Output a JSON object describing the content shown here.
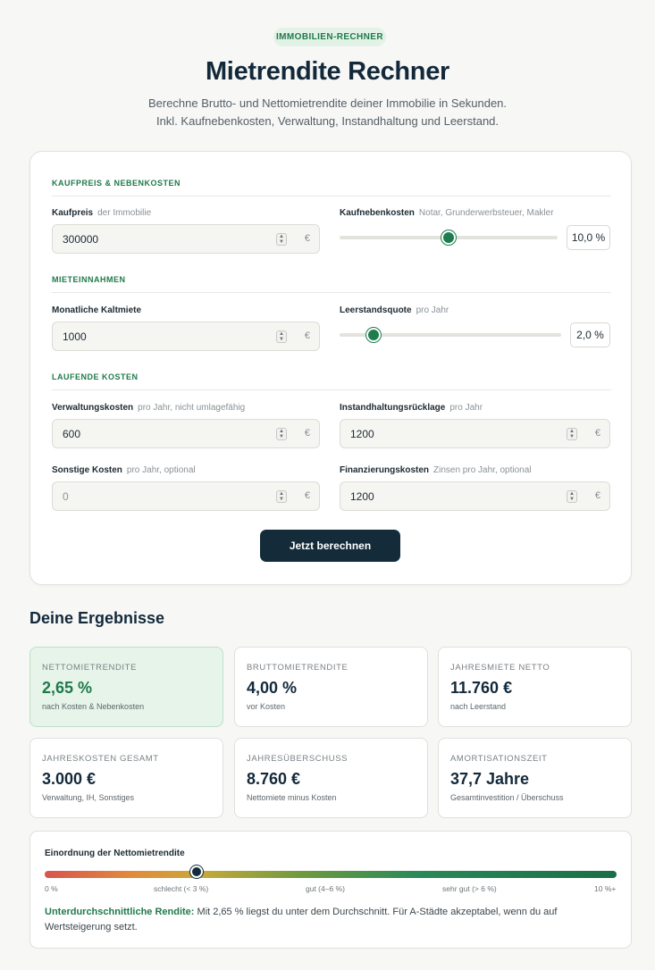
{
  "header": {
    "badge": "IMMOBILIEN-RECHNER",
    "title": "Mietrendite Rechner",
    "subtitle_line1": "Berechne Brutto- und Nettomietrendite deiner Immobilie in Sekunden.",
    "subtitle_line2": "Inkl. Kaufnebenkosten, Verwaltung, Instandhaltung und Leerstand."
  },
  "form": {
    "section_purchase": "KAUFPREIS & NEBENKOSTEN",
    "section_income": "MIETEINNAHMEN",
    "section_costs": "LAUFENDE KOSTEN",
    "kaufpreis": {
      "label": "Kaufpreis",
      "hint": "der Immobilie",
      "value": "300000",
      "unit": "€"
    },
    "kaufnebenkosten": {
      "label": "Kaufnebenkosten",
      "hint": "Notar, Grunderwerbsteuer, Makler",
      "display": "10,0 %",
      "fraction": 0.5
    },
    "kaltmiete": {
      "label": "Monatliche Kaltmiete",
      "hint": "",
      "value": "1000",
      "unit": "€"
    },
    "leerstandsquote": {
      "label": "Leerstandsquote",
      "hint": "pro Jahr",
      "display": "2,0 %",
      "fraction": 0.13
    },
    "verwaltung": {
      "label": "Verwaltungskosten",
      "hint": "pro Jahr, nicht umlagefähig",
      "value": "600",
      "unit": "€"
    },
    "instandhaltung": {
      "label": "Instandhaltungsrücklage",
      "hint": "pro Jahr",
      "value": "1200",
      "unit": "€"
    },
    "sonstige": {
      "label": "Sonstige Kosten",
      "hint": "pro Jahr, optional",
      "placeholder": "0",
      "unit": "€"
    },
    "finanzierung": {
      "label": "Finanzierungskosten",
      "hint": "Zinsen pro Jahr, optional",
      "value": "1200",
      "unit": "€"
    },
    "submit_label": "Jetzt berechnen"
  },
  "results": {
    "heading": "Deine Ergebnisse",
    "cards": [
      {
        "label": "NETTOMIETRENDITE",
        "value": "2,65 %",
        "note": "nach Kosten & Nebenkosten"
      },
      {
        "label": "BRUTTOMIETRENDITE",
        "value": "4,00 %",
        "note": "vor Kosten"
      },
      {
        "label": "JAHRESMIETE NETTO",
        "value": "11.760 €",
        "note": "nach Leerstand"
      },
      {
        "label": "JAHRESKOSTEN GESAMT",
        "value": "3.000 €",
        "note": "Verwaltung, IH, Sonstiges"
      },
      {
        "label": "JAHRESÜBERSCHUSS",
        "value": "8.760 €",
        "note": "Nettomiete minus Kosten"
      },
      {
        "label": "AMORTISATIONSZEIT",
        "value": "37,7 Jahre",
        "note": "Gesamtinvestition / Überschuss"
      }
    ]
  },
  "scale": {
    "title": "Einordnung der Nettomietrendite",
    "marker_fraction": 0.265,
    "ticks": [
      "0 %",
      "schlecht (< 3 %)",
      "gut (4–6 %)",
      "sehr gut (> 6 %)",
      "10 %+"
    ],
    "verdict": "Unterdurchschnittliche Rendite:",
    "explanation": "Mit 2,65 % liegst du unter dem Durchschnitt. Für A-Städte akzeptabel, wenn du auf Wertsteigerung setzt."
  },
  "colors": {
    "accent_green": "#1f7a4a",
    "navy": "#142b3a",
    "highlight_bg": "#e7f4ea"
  }
}
